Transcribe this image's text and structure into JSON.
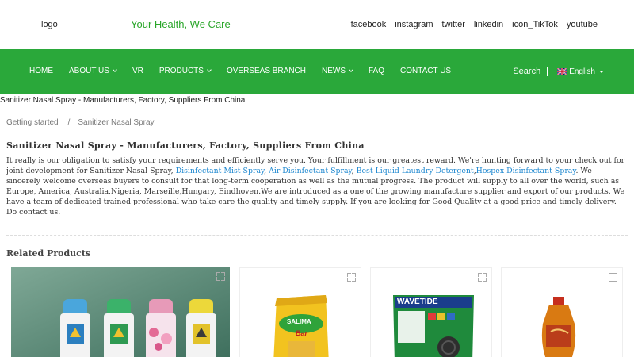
{
  "header": {
    "logo_text": "logo",
    "slogan": "Your Health, We Care",
    "social": [
      "facebook",
      "instagram",
      "twitter",
      "linkedin",
      "icon_TikTok",
      "youtube"
    ]
  },
  "nav": {
    "items": [
      {
        "label": "HOME",
        "dropdown": false
      },
      {
        "label": "ABOUT US",
        "dropdown": true
      },
      {
        "label": "VR",
        "dropdown": false
      },
      {
        "label": "PRODUCTS",
        "dropdown": true
      },
      {
        "label": "OVERSEAS BRANCH",
        "dropdown": false
      },
      {
        "label": "NEWS",
        "dropdown": true
      },
      {
        "label": "FAQ",
        "dropdown": false
      },
      {
        "label": "CONTACT US",
        "dropdown": false
      }
    ],
    "search_label": "Search",
    "language_label": "English"
  },
  "page_heading": "Sanitizer Nasal Spray - Manufacturers, Factory, Suppliers From China",
  "breadcrumb": {
    "items": [
      "Getting started",
      "Sanitizer Nasal Spray"
    ],
    "separator": "/"
  },
  "content": {
    "title": "Sanitizer Nasal Spray - Manufacturers, Factory, Suppliers From China",
    "segments": [
      {
        "text": "It really is our obligation to satisfy your requirements and efficiently serve you. Your fulfillment is our greatest reward. We're hunting forward to your check out for joint development for Sanitizer Nasal Spray, ",
        "link": false
      },
      {
        "text": "Disinfectant Mist Spray",
        "link": true
      },
      {
        "text": ", ",
        "link": false
      },
      {
        "text": "Air Disinfectant Spray",
        "link": true
      },
      {
        "text": ", ",
        "link": false
      },
      {
        "text": "Best Liquid Laundry Detergent",
        "link": true
      },
      {
        "text": ",",
        "link": false
      },
      {
        "text": "Hospex Disinfectant Spray",
        "link": true
      },
      {
        "text": ". We sincerely welcome overseas buyers to consult for that long-term cooperation as well as the mutual progress. The product will supply to all over the world, such as Europe, America, Australia,Nigeria, Marseille,Hungary, Eindhoven.We are introduced as a one of the growing manufacture supplier and export of our products. We have a team of dedicated trained professional who take care the quality and timely supply. If you are looking for Good Quality at a good price and timely delivery. Do contact us.",
        "link": false
      }
    ]
  },
  "related": {
    "title": "Related Products",
    "products": [
      {
        "image": "spray-cans-image"
      },
      {
        "image": "salima-bar-image",
        "brand_text": "SALIMA",
        "sub_text": "Bar"
      },
      {
        "image": "wavetide-mosquito-coil-image",
        "brand_text": "WAVETIDE"
      },
      {
        "image": "balm-bottle-image"
      }
    ]
  },
  "colors": {
    "brand_green": "#2aa83a",
    "link_blue": "#1e88d0",
    "slogan_green": "#2aa62a"
  }
}
